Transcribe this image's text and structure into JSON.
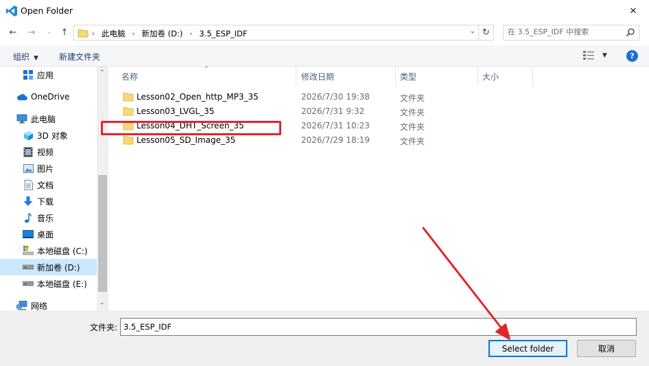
{
  "window": {
    "title": "Open Folder",
    "close_symbol": "✕"
  },
  "address": {
    "crumbs": [
      "此电脑",
      "新加卷 (D:)",
      "3.5_ESP_IDF"
    ],
    "search_placeholder": "在 3.5_ESP_IDF 中搜索"
  },
  "toolbar": {
    "organize_label": "组织",
    "new_folder_label": "新建文件夹",
    "help_label": "?"
  },
  "sidebar": {
    "items": [
      {
        "label": "应用",
        "icon": "apps-icon"
      },
      {
        "label": "OneDrive",
        "icon": "cloud-icon"
      },
      {
        "label": "此电脑",
        "icon": "computer-icon"
      },
      {
        "label": "3D 对象",
        "icon": "cube-icon"
      },
      {
        "label": "视频",
        "icon": "video-icon"
      },
      {
        "label": "图片",
        "icon": "picture-icon"
      },
      {
        "label": "文档",
        "icon": "document-icon"
      },
      {
        "label": "下载",
        "icon": "download-icon"
      },
      {
        "label": "音乐",
        "icon": "music-icon"
      },
      {
        "label": "桌面",
        "icon": "desktop-icon"
      },
      {
        "label": "本地磁盘 (C:)",
        "icon": "drive-c-icon"
      },
      {
        "label": "新加卷 (D:)",
        "icon": "drive-icon"
      },
      {
        "label": "本地磁盘 (E:)",
        "icon": "drive-icon"
      },
      {
        "label": "网络",
        "icon": "network-icon"
      }
    ],
    "selected_index": 11
  },
  "columns": {
    "name": "名称",
    "date": "修改日期",
    "type": "类型",
    "size": "大小"
  },
  "files": [
    {
      "name": "Lesson02_Open_http_MP3_35",
      "date": "2026/7/30 19:38",
      "type": "文件夹"
    },
    {
      "name": "Lesson03_LVGL_35",
      "date": "2026/7/31 9:32",
      "type": "文件夹"
    },
    {
      "name": "Lesson04_DHT_Screen_35",
      "date": "2026/7/31 10:23",
      "type": "文件夹"
    },
    {
      "name": "Lesson05_SD_Image_35",
      "date": "2026/7/29 18:19",
      "type": "文件夹"
    }
  ],
  "highlighted_file_index": 2,
  "bottom": {
    "folder_label": "文件夹:",
    "folder_value": "3.5_ESP_IDF",
    "select_button": "Select folder",
    "cancel_button": "取消"
  },
  "colors": {
    "accent": "#0078d7",
    "annotation": "#e3242b",
    "folder": "#f8d775",
    "selected_bg": "#cce8ff"
  }
}
